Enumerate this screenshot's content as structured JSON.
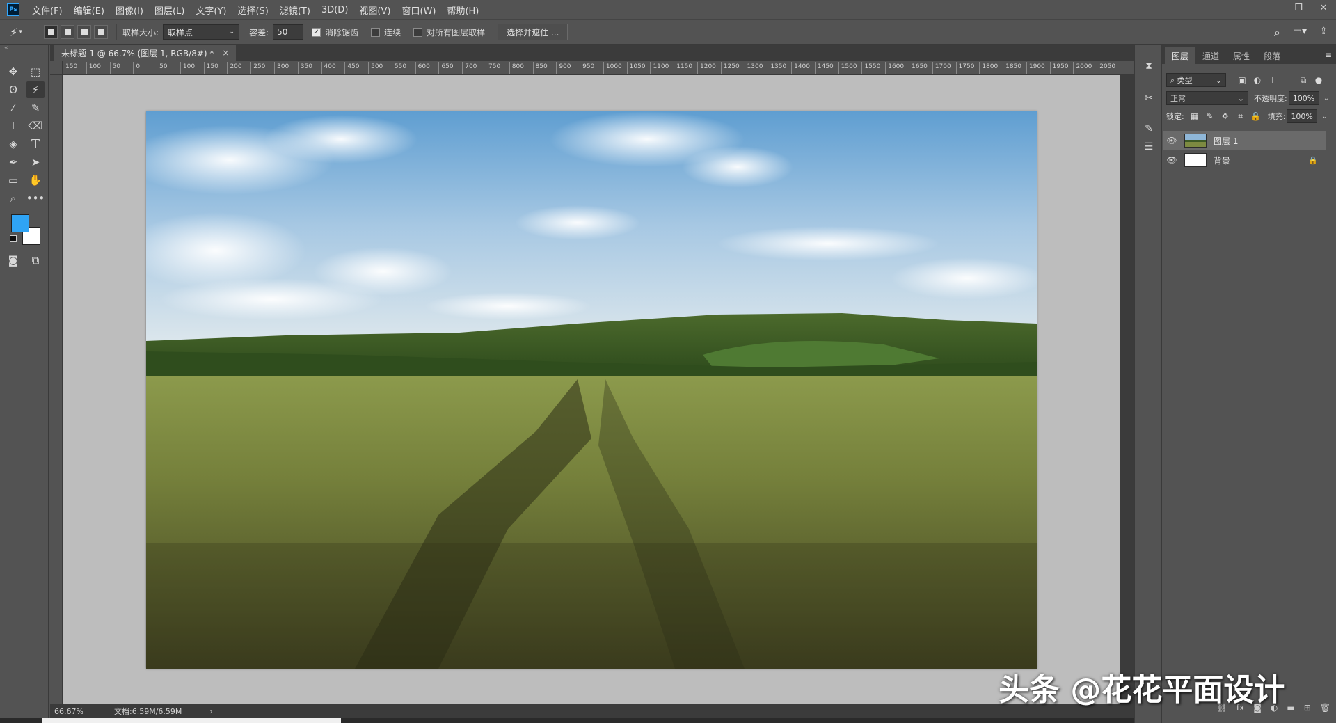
{
  "app": {
    "logo": "Ps"
  },
  "menu": [
    "文件(F)",
    "编辑(E)",
    "图像(I)",
    "图层(L)",
    "文字(Y)",
    "选择(S)",
    "滤镜(T)",
    "3D(D)",
    "视图(V)",
    "窗口(W)",
    "帮助(H)"
  ],
  "window_controls": {
    "minimize": "—",
    "restore": "❐",
    "close": "✕"
  },
  "options": {
    "sample_size_label": "取样大小:",
    "sample_size_value": "取样点",
    "tolerance_label": "容差:",
    "tolerance_value": "50",
    "antialias_label": "消除锯齿",
    "antialias_checked": true,
    "contiguous_label": "连续",
    "contiguous_checked": false,
    "sample_all_label": "对所有图层取样",
    "sample_all_checked": false,
    "select_mask_button": "选择并遮住 ..."
  },
  "colors": {
    "foreground": "#2fa4f5",
    "background": "#ffffff",
    "accent": "#31a8ff"
  },
  "document": {
    "tab_title": "未标题-1 @ 66.7% (图层 1, RGB/8#) *",
    "tab_close": "×",
    "ruler_ticks": [
      "150",
      "100",
      "50",
      "0",
      "50",
      "100",
      "150",
      "200",
      "250",
      "300",
      "350",
      "400",
      "450",
      "500",
      "550",
      "600",
      "650",
      "700",
      "750",
      "800",
      "850",
      "900",
      "950",
      "1000",
      "1050",
      "1100",
      "1150",
      "1200",
      "1250",
      "1300",
      "1350",
      "1400",
      "1450",
      "1500",
      "1550",
      "1600",
      "1650",
      "1700",
      "1750",
      "1800",
      "1850",
      "1900",
      "1950",
      "2000",
      "2050"
    ],
    "zoom": "66.67%",
    "doc_info": "文档:6.59M/6.59M",
    "status_arrow": "›"
  },
  "layers_panel": {
    "tabs": [
      "图层",
      "通道",
      "属性",
      "段落"
    ],
    "menu_icon": "≡",
    "filter_kind": "类型",
    "blend_mode": "正常",
    "opacity_label": "不透明度:",
    "opacity_value": "100%",
    "lock_label": "锁定:",
    "fill_label": "填充:",
    "fill_value": "100%",
    "layers": [
      {
        "name": "图层 1",
        "selected": true,
        "locked": false
      },
      {
        "name": "背景",
        "selected": false,
        "locked": true
      }
    ],
    "bottom_icons": [
      "link-icon",
      "fx-icon",
      "mask-icon",
      "adjustment-icon",
      "group-folder-icon",
      "new-layer-icon",
      "trash-icon"
    ],
    "bottom_glyphs": [
      "⛓",
      "fx",
      "◙",
      "◐",
      "▬",
      "⊞",
      "🗑"
    ]
  },
  "watermark": "头条 @花花平面设计"
}
